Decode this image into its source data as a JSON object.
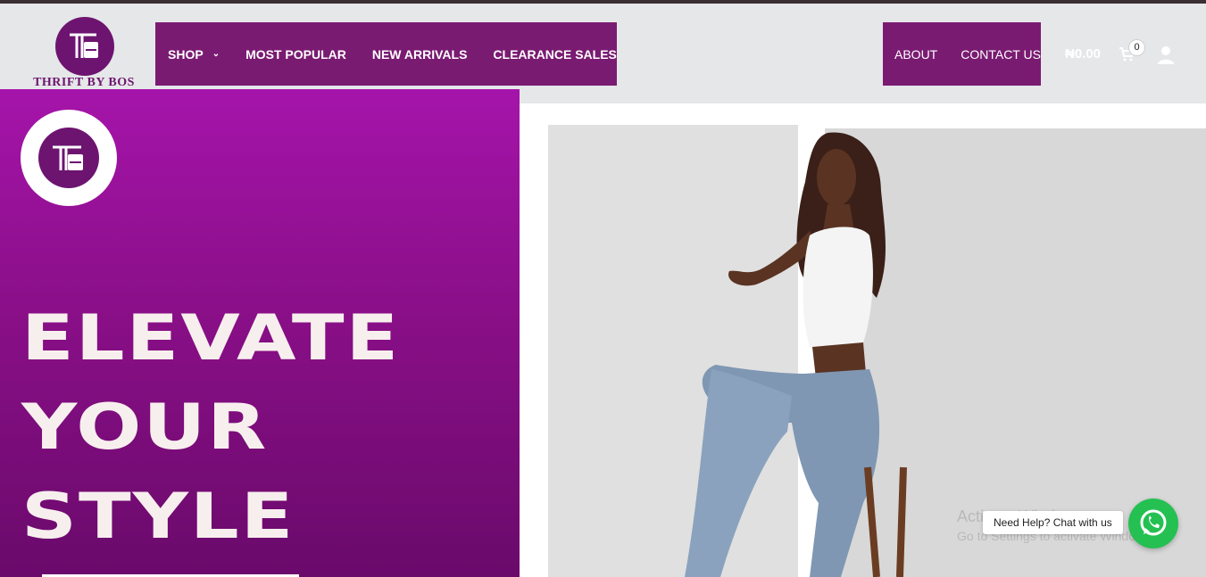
{
  "brand": {
    "name": "THRIFT BY BOS",
    "primary": "#7a1b72",
    "accent": "#a514aa"
  },
  "nav": {
    "left": [
      {
        "label": "SHOP",
        "icon": "chevron-down-icon"
      },
      {
        "label": "MOST POPULAR"
      },
      {
        "label": "NEW ARRIVALS"
      },
      {
        "label": "CLEARANCE SALES"
      }
    ],
    "right": [
      {
        "label": "ABOUT"
      },
      {
        "label": "CONTACT US"
      }
    ]
  },
  "cart": {
    "total": "₦0.00",
    "count": "0",
    "icon": "cart-icon"
  },
  "account": {
    "icon": "user-icon"
  },
  "hero": {
    "line1": "ELEVATE",
    "line2": "YOUR",
    "line3": "STYLE"
  },
  "chat": {
    "label": "Need Help? Chat with us",
    "icon": "whatsapp-icon",
    "color": "#25c052"
  },
  "os_watermark": {
    "title": "Activate Windows",
    "subtitle": "Go to Settings to activate Windows."
  }
}
